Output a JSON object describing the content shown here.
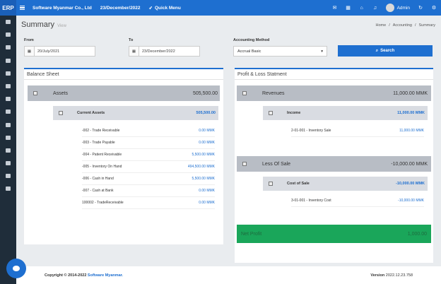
{
  "topbar": {
    "brand": "ERP",
    "company": "Software Myanmar Co., Ltd",
    "date": "23/December/2022",
    "quick_menu": "Quick Menu",
    "user": "Admin"
  },
  "page": {
    "title": "Summary",
    "subtitle": "View",
    "breadcrumb": [
      "Home",
      "Accounting",
      "Summary"
    ]
  },
  "filters": {
    "from_label": "From",
    "from_value": "20/July/2021",
    "to_label": "To",
    "to_value": "23/December/2022",
    "method_label": "Accounting Method",
    "method_value": "Accrual Basic",
    "search_label": "Search"
  },
  "balance_sheet": {
    "title": "Balance Sheet",
    "group_label": "Assets",
    "group_amount": "505,500.00",
    "sub_label": "Current Assets",
    "sub_amount": "505,500.00",
    "lines": [
      {
        "name": "-002 - Trade Receivable",
        "amount": "0.00 MMK"
      },
      {
        "name": "-003 - Trade Payable",
        "amount": "0.00 MMK"
      },
      {
        "name": "-004 - Patient Receivable",
        "amount": "5,500.00 MMK"
      },
      {
        "name": "-005 - Inventory On Hand",
        "amount": "494,500.00 MMK"
      },
      {
        "name": "-006 - Cash in Hand",
        "amount": "5,500.00 MMK"
      },
      {
        "name": "-007 - Cash at Bank",
        "amount": "0.00 MMK"
      },
      {
        "name": "100002 - TradeReceivable",
        "amount": "0.00 MMK"
      }
    ]
  },
  "pnl": {
    "title": "Profit & Loss Statment",
    "revenues_label": "Revenues",
    "revenues_amount": "11,000.00 MMK",
    "income_label": "Income",
    "income_amount": "11,000.00 MMK",
    "income_line": {
      "name": "2-01-001 - Inventory Sale",
      "amount": "11,000.00 MMK"
    },
    "less_label": "Less Of Sale",
    "less_amount": "-10,000.00 MMK",
    "cost_label": "Cost of Sale",
    "cost_amount": "-10,000.00 MMK",
    "cost_line": {
      "name": "3-01-001 - Inventory Cost",
      "amount": "-10,000.00 MMK"
    },
    "net_label": "Net Profit",
    "net_amount": "1,000.00"
  },
  "footer": {
    "copyright": "Copyright © 2014-2022",
    "company": "Software Myanmar.",
    "version_label": "Version",
    "version": "2022.12.23.758"
  }
}
